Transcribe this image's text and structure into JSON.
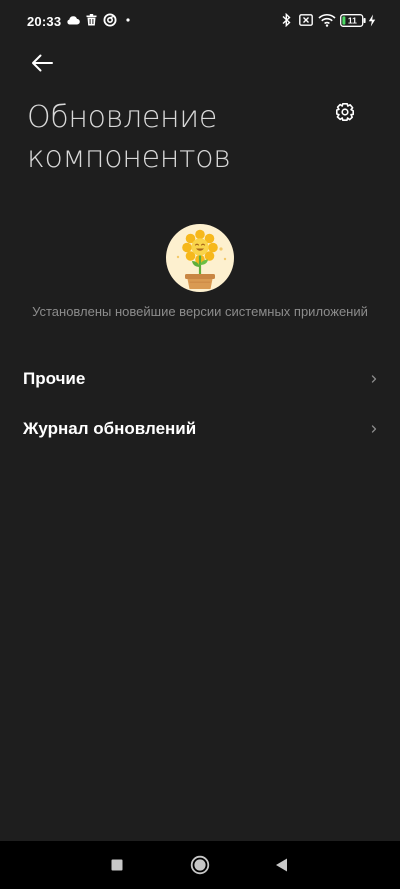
{
  "status_bar": {
    "time": "20:33",
    "battery_level": "11",
    "icons": [
      "cloud-icon",
      "trash-icon",
      "app-notification-icon",
      "dot-icon",
      "bluetooth-icon",
      "sim-off-icon",
      "wifi-icon",
      "battery-icon",
      "charging-icon"
    ]
  },
  "header": {
    "back_icon": "arrow-left-icon",
    "settings_icon": "gear-icon",
    "title_line1": "Обновление",
    "title_line2": "компонентов"
  },
  "hero": {
    "illustration": "sunflower-pot-icon",
    "message": "Установлены новейшие версии системных приложений"
  },
  "menu": {
    "items": [
      {
        "label": "Прочие",
        "icon": "chevron-right-icon"
      },
      {
        "label": "Журнал обновлений",
        "icon": "chevron-right-icon"
      }
    ]
  },
  "nav_bar": {
    "buttons": [
      "recents-square-icon",
      "home-circle-icon",
      "back-triangle-icon"
    ]
  },
  "colors": {
    "background": "#1e1e1e",
    "title": "#d8d8d8",
    "message": "#8c8c8c",
    "accent_sun": "#f6b81c",
    "pot": "#d99a52"
  }
}
